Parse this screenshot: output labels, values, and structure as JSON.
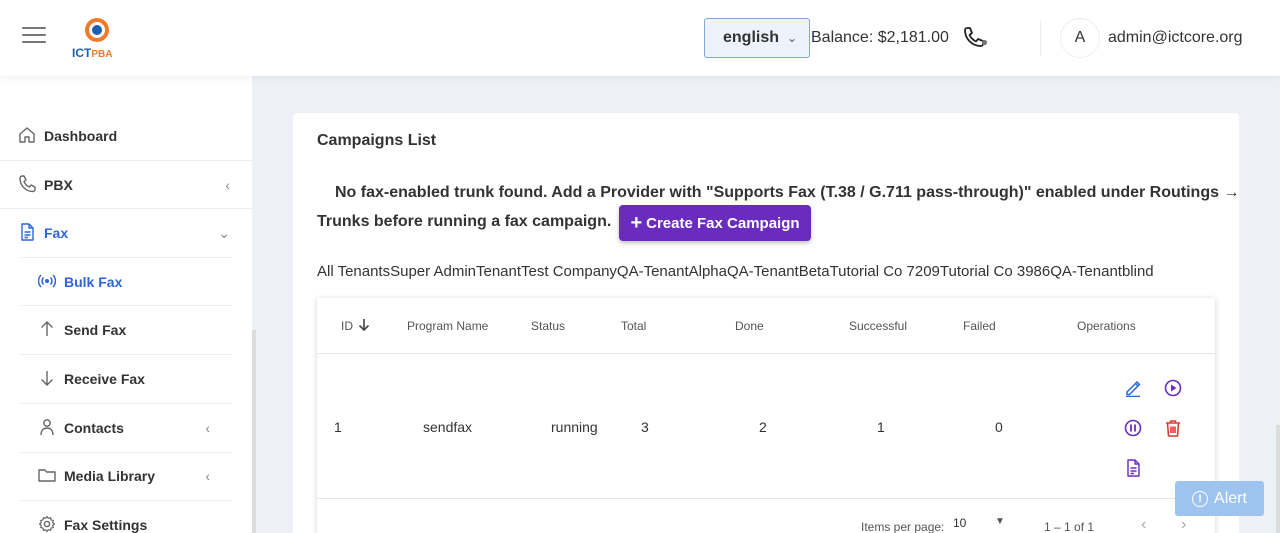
{
  "header": {
    "logo_text_ict": "ICT",
    "logo_text_pba": "PBA",
    "language": "english",
    "balance": "Balance: $2,181.00",
    "avatar_initial": "A",
    "user_email": "admin@ictcore.org"
  },
  "sidebar": {
    "items": [
      {
        "label": "Dashboard",
        "icon": "home-icon"
      },
      {
        "label": "PBX",
        "icon": "phone-icon"
      },
      {
        "label": "Fax",
        "icon": "document-icon"
      },
      {
        "label": "Bulk Fax",
        "icon": "broadcast-icon"
      },
      {
        "label": "Send Fax",
        "icon": "arrow-up-icon"
      },
      {
        "label": "Receive Fax",
        "icon": "arrow-down-icon"
      },
      {
        "label": "Contacts",
        "icon": "person-icon"
      },
      {
        "label": "Media Library",
        "icon": "folder-icon"
      },
      {
        "label": "Fax Settings",
        "icon": "gear-icon"
      }
    ]
  },
  "main": {
    "title": "Campaigns List",
    "warning_line1": "No fax-enabled trunk found. Add a Provider with \"Supports Fax (T.38 / G.711 pass-through)\" enabled under Routings →",
    "warning_line2": "Trunks before running a fax campaign.",
    "create_button": "Create Fax Campaign",
    "tenants": [
      "All Tenants",
      "Super Admin",
      "Tenant",
      "Test Company",
      "QA-TenantAlpha",
      "QA-TenantBeta",
      "Tutorial Co 7209",
      "Tutorial Co 3986",
      "QA-Tenantblind"
    ]
  },
  "table": {
    "headers": [
      "ID",
      "Program Name",
      "Status",
      "Total",
      "Done",
      "Successful",
      "Failed",
      "Operations"
    ],
    "rows": [
      {
        "id": "1",
        "program": "sendfax",
        "status": "running",
        "total": "3",
        "done": "2",
        "successful": "1",
        "failed": "0"
      }
    ],
    "items_per_page_label": "Items per page:",
    "items_per_page": "10",
    "range": "1 – 1 of 1"
  },
  "alert": {
    "label": "Alert"
  },
  "colors": {
    "accent": "#6a2bbf",
    "active_link": "#2e65d8",
    "delete": "#e53935"
  }
}
